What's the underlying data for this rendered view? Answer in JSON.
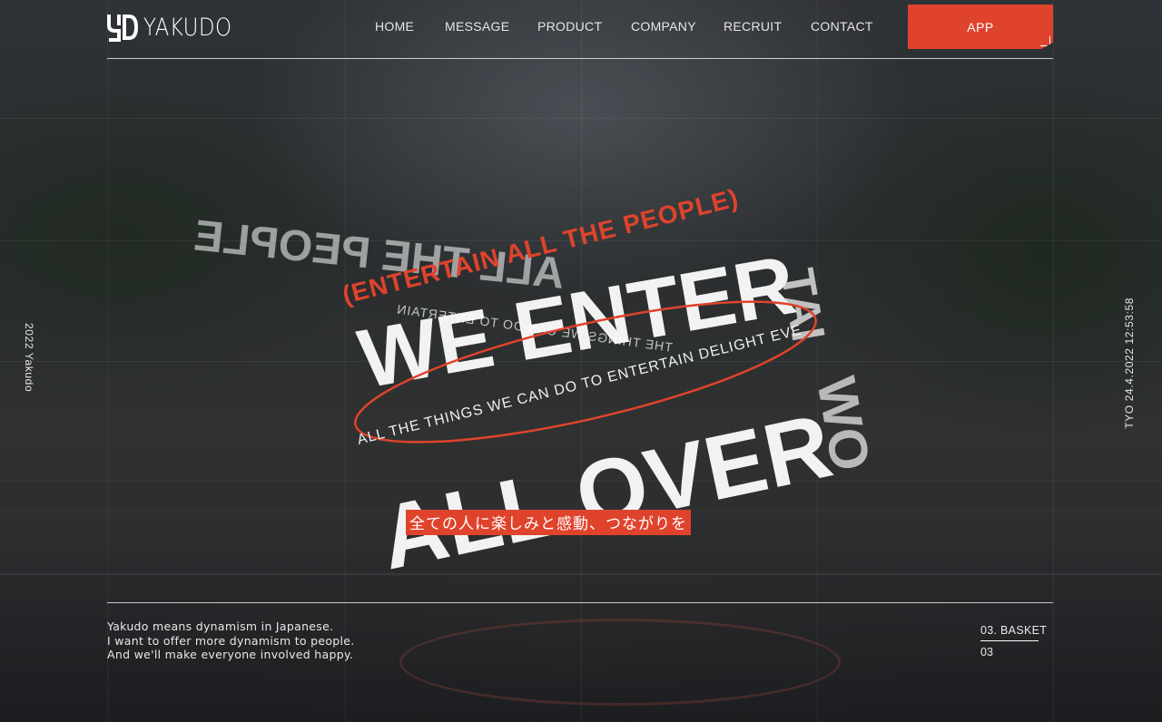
{
  "brand": {
    "name": "YAKUDO",
    "mark": "YD"
  },
  "nav": {
    "items": [
      "HOME",
      "MESSAGE",
      "PRODUCT",
      "COMPANY",
      "RECRUIT",
      "CONTACT"
    ],
    "app_label": "APP"
  },
  "side": {
    "left": "2022 Yakudo",
    "right": "TYO 24.4.2022 12:53:58"
  },
  "hero": {
    "ring_top": "(ENTERTAIN ALL THE PEOPLE)",
    "ring_top_mirror": "ALL THE PEOPLE",
    "headline_1": "WE ENTER",
    "headline_2": "ALL OVER",
    "headline_2_mirror": "WO",
    "headline_right": "TAI",
    "band_text": "ALL THE THINGS WE CAN DO TO ENTERTAIN DELIGHT EVE",
    "band_mirror": "THE THINGS WE CAN DO TO ENTERTAIN",
    "jp_tagline": "全ての人に楽しみと感動、つながりを"
  },
  "footer": {
    "description": [
      "Yakudo means dynamism in Japanese.",
      "I want to offer more dynamism to people.",
      "And we'll make everyone involved happy."
    ],
    "scene_name": "03. BASKET",
    "scene_num": "03"
  },
  "colors": {
    "accent": "#e0432c",
    "text": "#ffffff"
  }
}
